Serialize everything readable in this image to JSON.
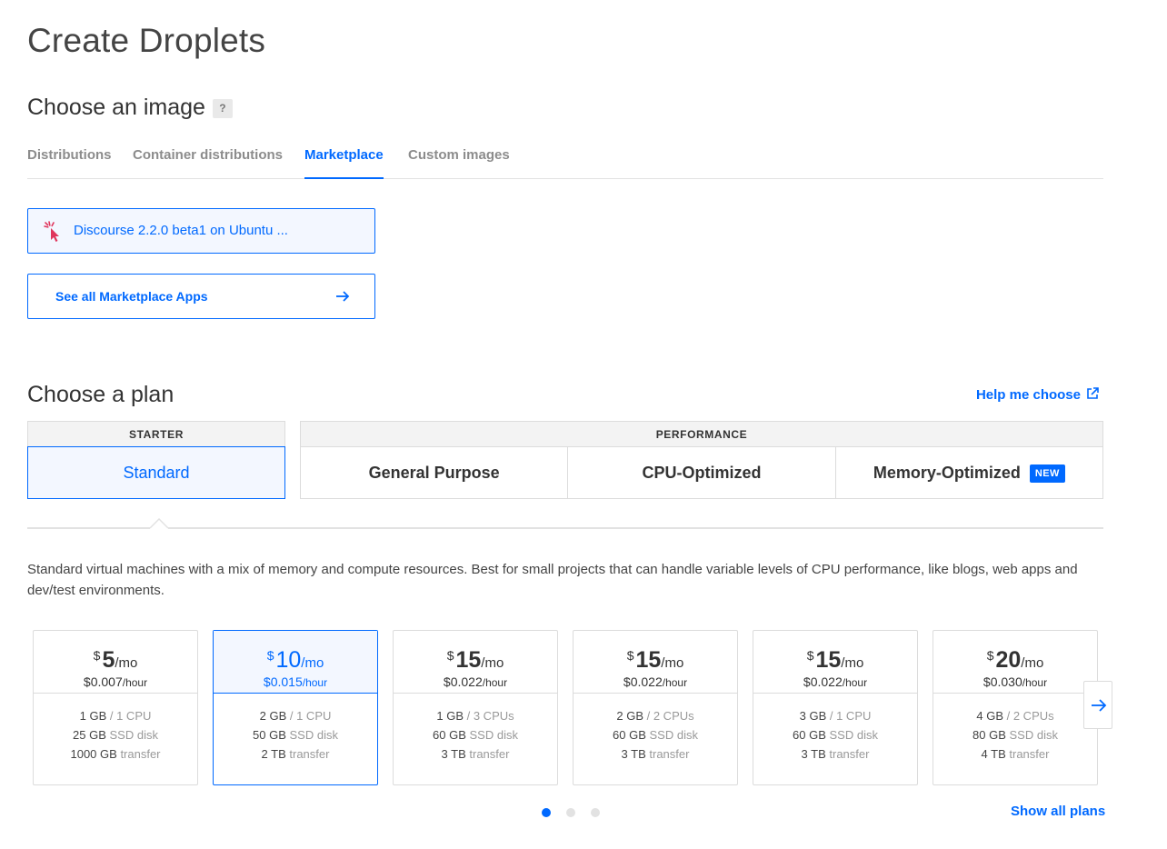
{
  "page_title": "Create Droplets",
  "image_section": {
    "title": "Choose an image",
    "help": "?",
    "tabs": [
      "Distributions",
      "Container distributions",
      "Marketplace",
      "Custom images"
    ],
    "active_tab": "Marketplace",
    "selected_app": "Discourse 2.2.0 beta1 on Ubuntu ...",
    "see_all_label": "See all Marketplace Apps"
  },
  "plan_section": {
    "title": "Choose a plan",
    "help_link": "Help me choose",
    "groups": {
      "starter": {
        "label": "STARTER",
        "tabs": [
          "Standard"
        ]
      },
      "performance": {
        "label": "PERFORMANCE",
        "tabs": [
          "General Purpose",
          "CPU-Optimized",
          "Memory-Optimized"
        ]
      }
    },
    "active_plan_tab": "Standard",
    "new_badge": "NEW",
    "description": "Standard virtual machines with a mix of memory and compute resources. Best for small projects that can handle variable levels of CPU performance, like blogs, web apps and dev/test environments.",
    "cards": [
      {
        "currency": "$",
        "monthly": "5",
        "per_month": "/mo",
        "hourly": "$0.007",
        "per_hour": "/hour",
        "memory": "1 GB",
        "cpu": "/ 1 CPU",
        "disk": "25 GB",
        "disk_unit": "SSD disk",
        "transfer": "1000 GB",
        "transfer_unit": "transfer"
      },
      {
        "currency": "$",
        "monthly": "10",
        "per_month": "/mo",
        "hourly": "$0.015",
        "per_hour": "/hour",
        "memory": "2 GB",
        "cpu": "/ 1 CPU",
        "disk": "50 GB",
        "disk_unit": "SSD disk",
        "transfer": "2 TB",
        "transfer_unit": "transfer"
      },
      {
        "currency": "$",
        "monthly": "15",
        "per_month": "/mo",
        "hourly": "$0.022",
        "per_hour": "/hour",
        "memory": "1 GB",
        "cpu": "/ 3 CPUs",
        "disk": "60 GB",
        "disk_unit": "SSD disk",
        "transfer": "3 TB",
        "transfer_unit": "transfer"
      },
      {
        "currency": "$",
        "monthly": "15",
        "per_month": "/mo",
        "hourly": "$0.022",
        "per_hour": "/hour",
        "memory": "2 GB",
        "cpu": "/ 2 CPUs",
        "disk": "60 GB",
        "disk_unit": "SSD disk",
        "transfer": "3 TB",
        "transfer_unit": "transfer"
      },
      {
        "currency": "$",
        "monthly": "15",
        "per_month": "/mo",
        "hourly": "$0.022",
        "per_hour": "/hour",
        "memory": "3 GB",
        "cpu": "/ 1 CPU",
        "disk": "60 GB",
        "disk_unit": "SSD disk",
        "transfer": "3 TB",
        "transfer_unit": "transfer"
      },
      {
        "currency": "$",
        "monthly": "20",
        "per_month": "/mo",
        "hourly": "$0.030",
        "per_hour": "/hour",
        "memory": "4 GB",
        "cpu": "/ 2 CPUs",
        "disk": "80 GB",
        "disk_unit": "SSD disk",
        "transfer": "4 TB",
        "transfer_unit": "transfer"
      }
    ],
    "selected_card_index": 1,
    "pagination": {
      "pages": 3,
      "current": 1
    },
    "show_all_label": "Show all plans"
  },
  "colors": {
    "accent": "#0069ff",
    "selected_bg": "#f3f7ff",
    "pointer_icon": "#e0355c"
  },
  "icons": {
    "marketplace_pointer": "pointer-click-icon",
    "see_all_arrow": "arrow-right-icon",
    "help_link": "external-link-icon",
    "carousel_next": "arrow-right-icon"
  }
}
